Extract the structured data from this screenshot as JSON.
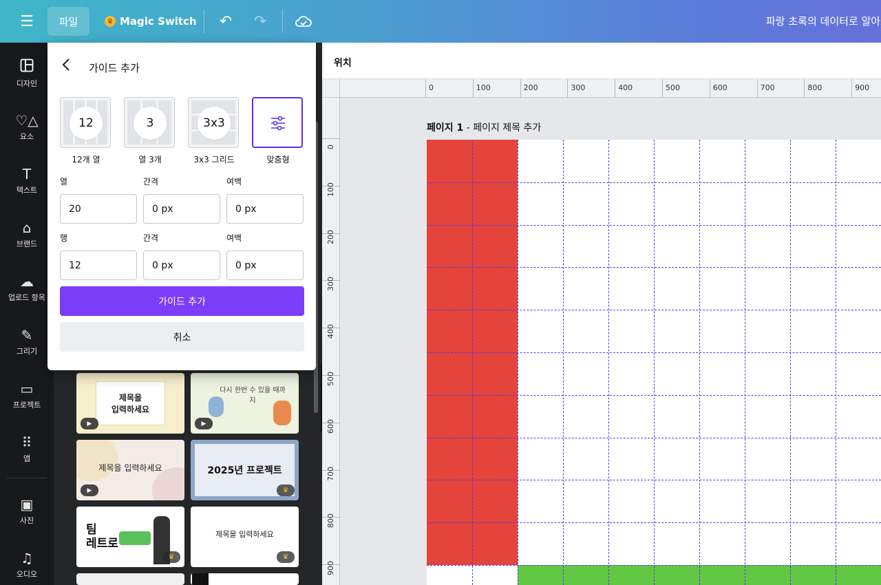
{
  "topbar": {
    "file_label": "파일",
    "magic_label": "Magic Switch",
    "doc_title": "파랑 초록의 데이터로 알아보"
  },
  "rail": {
    "items": [
      {
        "label": "디자인",
        "icon": "layout-icon"
      },
      {
        "label": "요소",
        "icon": "shapes-icon"
      },
      {
        "label": "텍스트",
        "icon": "text-icon"
      },
      {
        "label": "브랜드",
        "icon": "brand-icon"
      },
      {
        "label": "업로드 항목",
        "icon": "upload-icon"
      },
      {
        "label": "그리기",
        "icon": "draw-icon"
      },
      {
        "label": "프로젝트",
        "icon": "folder-icon"
      },
      {
        "label": "앱",
        "icon": "apps-icon"
      },
      {
        "label": "사진",
        "icon": "photo-icon"
      },
      {
        "label": "오디오",
        "icon": "audio-icon"
      }
    ]
  },
  "popup": {
    "title": "가이드 추가",
    "presets": [
      {
        "value": "12",
        "label": "12개 열"
      },
      {
        "value": "3",
        "label": "열 3개"
      },
      {
        "value": "3x3",
        "label": "3x3 그리드"
      },
      {
        "value": "",
        "label": "맞춤형"
      }
    ],
    "columns": {
      "label": "열",
      "value": "20"
    },
    "col_gap": {
      "label": "간격",
      "value": "0 px"
    },
    "col_margin": {
      "label": "여백",
      "value": "0 px"
    },
    "rows": {
      "label": "행",
      "value": "12"
    },
    "row_gap": {
      "label": "간격",
      "value": "0 px"
    },
    "row_margin": {
      "label": "여백",
      "value": "0 px"
    },
    "add_button": "가이드 추가",
    "cancel_button": "취소"
  },
  "templates": [
    {
      "title": "제목을\n입력하세요",
      "bg": "#f6efcc",
      "badge": "play"
    },
    {
      "title": "다시 한번 수 있을 때까지",
      "bg": "#eef3e0",
      "badge": "play"
    },
    {
      "title": "제목을 입력하세요",
      "bg": "#f3ece6",
      "badge": "play"
    },
    {
      "title": "2025년 프로젝트",
      "bg": "#8fa6c8",
      "badge": "crown"
    },
    {
      "title": "팀\n레트로",
      "bg": "#ffffff",
      "badge": "crown"
    },
    {
      "title": "제목을 입력하세요",
      "bg": "#ffffff",
      "badge": "crown"
    }
  ],
  "workspace": {
    "position_label": "위치",
    "page_label": "페이지 1",
    "page_title": "페이지 제목 추가",
    "ruler_top": [
      "0",
      "100",
      "200",
      "300",
      "400",
      "500",
      "600",
      "700",
      "800",
      "900"
    ],
    "ruler_left": [
      "0",
      "100",
      "200",
      "300",
      "400",
      "500",
      "600",
      "700",
      "800",
      "900"
    ]
  },
  "colors": {
    "accent": "#7d3cf8",
    "guide": "#4f3ee8",
    "red_block": "#e4443a",
    "green_block": "#62c744"
  }
}
